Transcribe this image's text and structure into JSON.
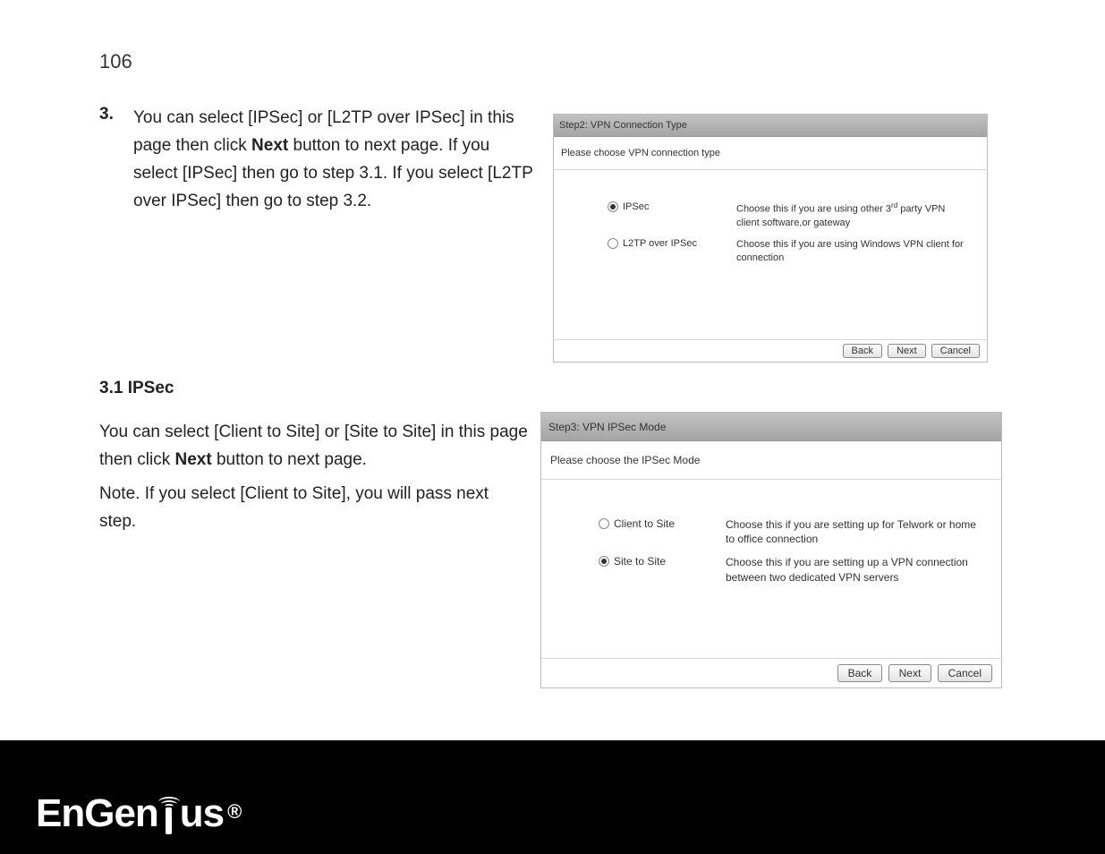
{
  "page_number": "106",
  "step3": {
    "number": "3.",
    "text_pre": "You can select [IPSec] or [L2TP over IPSec] in this page then click ",
    "next_label": "Next",
    "text_post": " button to next page. If you select [IPSec] then go to step 3.1. If you select [L2TP over IPSec] then go to step 3.2."
  },
  "section31_heading": "3.1 IPSec",
  "section31_text_pre": "You can select [Client to Site] or [Site to Site] in this page then click ",
  "section31_next": "Next",
  "section31_text_post": " button to next page.",
  "section31_note": "Note. If you select [Client to Site], you will pass next step.",
  "dialog1": {
    "title": "Step2: VPN Connection Type",
    "subhead": "Please choose VPN connection type",
    "opt1_label": "IPSec",
    "opt1_desc_pre": "Choose this if you are using other 3",
    "opt1_sup": "rd",
    "opt1_desc_post": " party VPN client software,or gateway",
    "opt2_label": "L2TP over IPSec",
    "opt2_desc": "Choose this if you are using Windows VPN client for connection",
    "back": "Back",
    "next": "Next",
    "cancel": "Cancel"
  },
  "dialog2": {
    "title": "Step3: VPN IPSec Mode",
    "subhead": "Please choose the IPSec Mode",
    "opt1_label": "Client to Site",
    "opt1_desc": "Choose this if you are setting up for Telwork or home to office connection",
    "opt2_label": "Site to Site",
    "opt2_desc": "Choose this if you are setting up a VPN connection between two dedicated VPN servers",
    "back": "Back",
    "next": "Next",
    "cancel": "Cancel"
  },
  "logo_text_pre": "EnGen",
  "logo_text_post": "us",
  "logo_reg": "®"
}
